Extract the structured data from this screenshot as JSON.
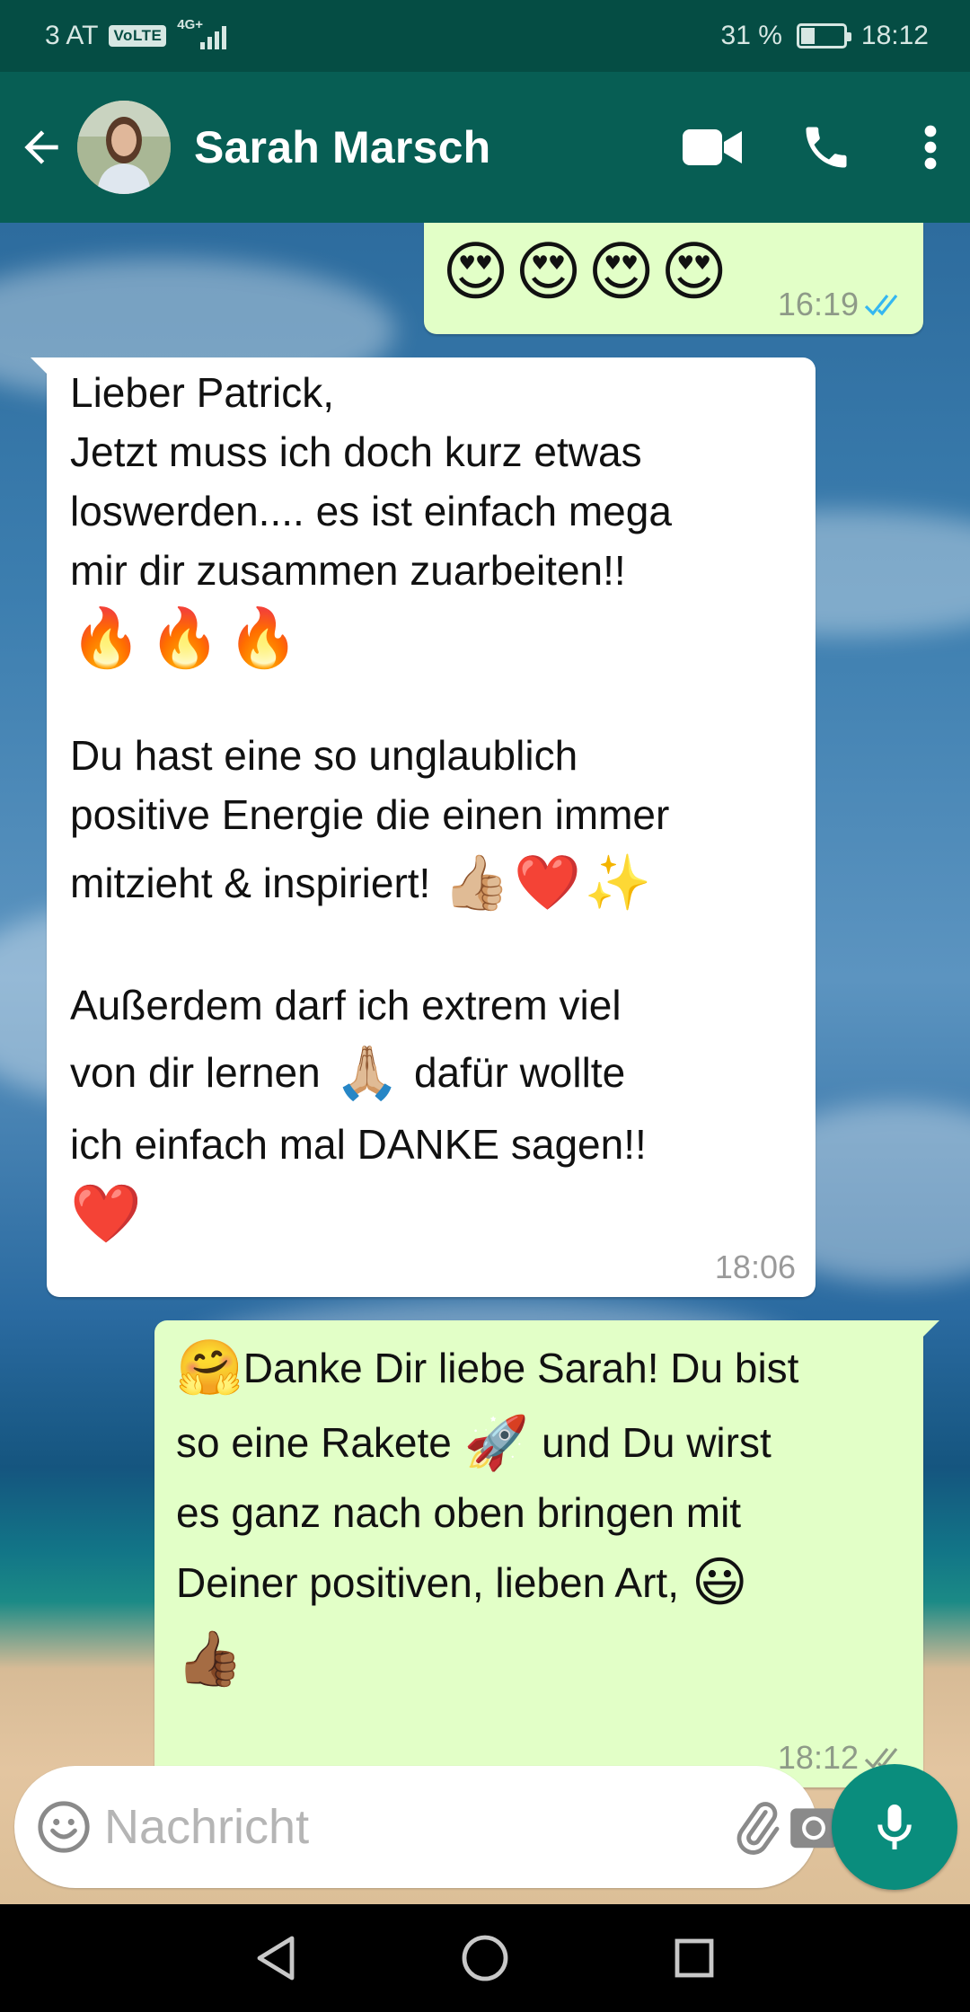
{
  "status_bar": {
    "carrier": "3 AT",
    "volte": "VoLTE",
    "network_tag": "4G+",
    "battery": "31 %",
    "battery_level": 0.31,
    "time": "18:12"
  },
  "header": {
    "contact_name": "Sarah Marsch",
    "icons": [
      "back-arrow-icon",
      "video-call-icon",
      "phone-icon",
      "more-vertical-icon"
    ]
  },
  "messages": [
    {
      "direction": "outgoing",
      "emoji": "😍😍😍😍",
      "time": "16:19",
      "status": "read",
      "tick_color": "#34b7f1"
    },
    {
      "direction": "incoming",
      "lines": {
        "l1": "Lieber Patrick,",
        "l2": "Jetzt muss ich doch kurz etwas",
        "l3": "loswerden.... es ist einfach mega",
        "l4": "mir dir zusammen zuarbeiten!!",
        "e1": "🔥🔥🔥",
        "l5": "Du hast eine so unglaublich",
        "l6": "positive Energie die einen immer",
        "l7": "mitzieht & inspiriert!",
        "e2": "👍🏼❤️✨",
        "l8": "Außerdem darf ich extrem viel",
        "l9a": "von dir lernen",
        "e3": "🙏🏼",
        "l9b": "dafür wollte",
        "l10": "ich einfach mal DANKE sagen!!",
        "e4": "❤️"
      },
      "time": "18:06"
    },
    {
      "direction": "outgoing",
      "lines": {
        "e1": "🤗",
        "l1": "Danke Dir liebe Sarah! Du bist",
        "l2a": "so eine Rakete",
        "e2": "🚀",
        "l2b": "und Du wirst",
        "l3": "es ganz nach oben bringen mit",
        "l4": "Deiner positiven, lieben Art,",
        "e3": "😃",
        "e4": "👍🏾"
      },
      "time": "18:12",
      "status": "delivered",
      "tick_color": "#8e9a88"
    }
  ],
  "composer": {
    "placeholder": "Nachricht",
    "icons": [
      "emoji-icon",
      "attach-icon",
      "camera-icon",
      "mic-icon"
    ]
  },
  "nav": {
    "icons": [
      "back-triangle-icon",
      "home-circle-icon",
      "recents-square-icon"
    ]
  },
  "colors": {
    "header": "#075e54",
    "status": "#054d44",
    "outgoing_bubble": "#e2ffc7",
    "incoming_bubble": "#ffffff",
    "accent": "#0a8d7d"
  }
}
